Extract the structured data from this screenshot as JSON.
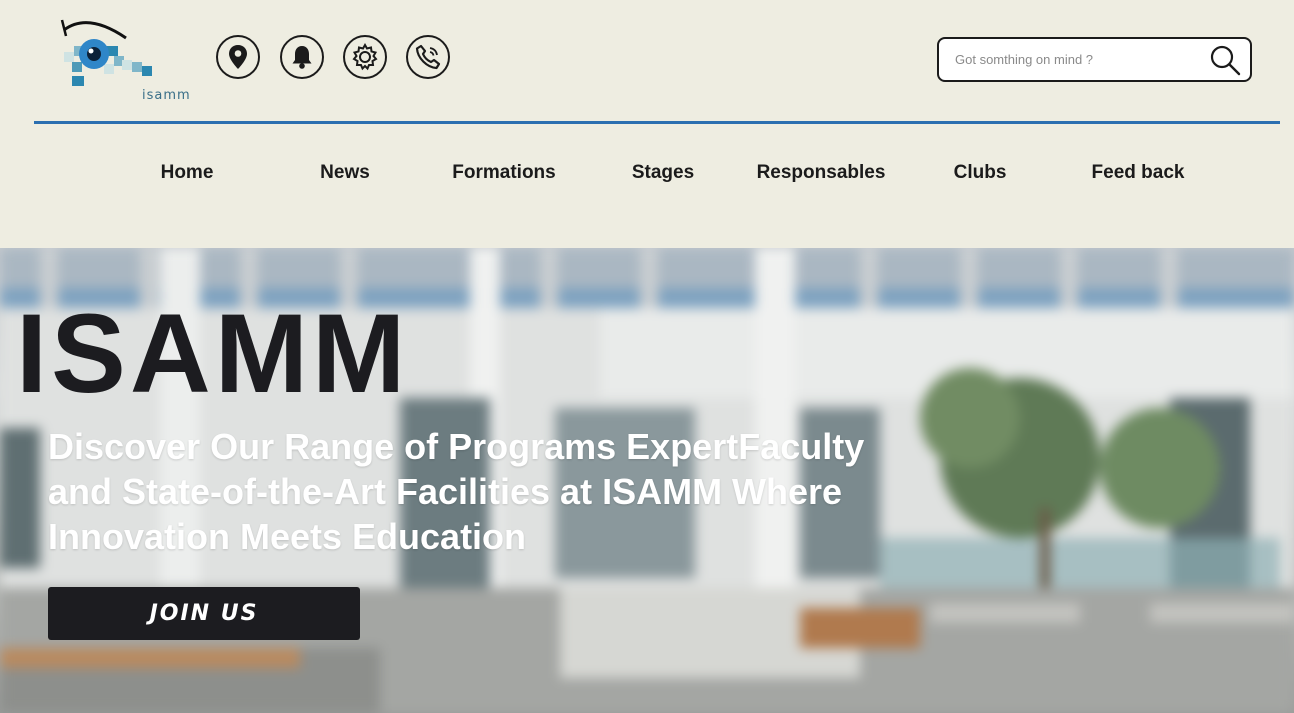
{
  "header": {
    "logo_text": "isamm",
    "search": {
      "placeholder": "Got somthing on mind ?"
    }
  },
  "nav": {
    "items": [
      {
        "label": "Home"
      },
      {
        "label": "News"
      },
      {
        "label": "Formations"
      },
      {
        "label": "Stages"
      },
      {
        "label": "Responsables"
      },
      {
        "label": "Clubs"
      },
      {
        "label": "Feed back"
      }
    ]
  },
  "hero": {
    "title": "ISAMM",
    "subtitle": "Discover Our Range of Programs ExpertFaculty and State-of-the-Art Facilities at ISAMM Where Innovation Meets Education",
    "cta_label": "JOIN US"
  },
  "colors": {
    "header_bg": "#eeede1",
    "accent_line": "#2b6fb0",
    "dark": "#1c1c20"
  },
  "icons": [
    "location-icon",
    "bell-icon",
    "settings-icon",
    "phone-icon",
    "search-icon"
  ]
}
